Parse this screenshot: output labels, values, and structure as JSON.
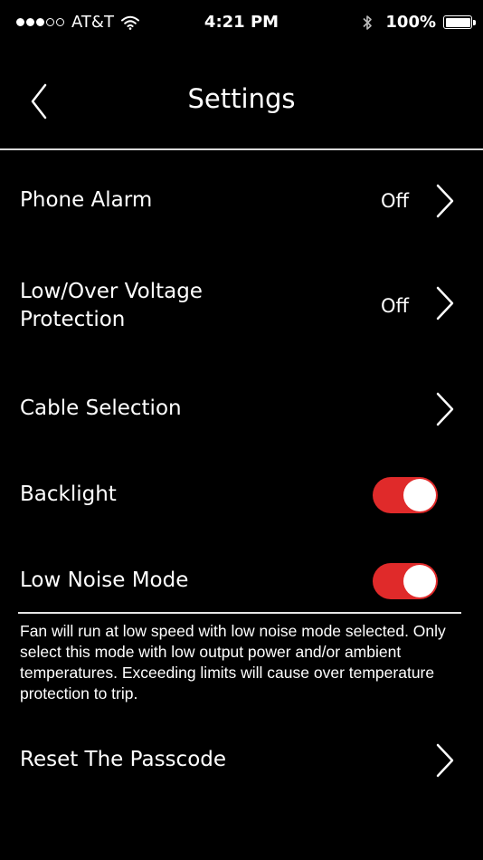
{
  "status_bar": {
    "signal_filled": 3,
    "signal_total": 5,
    "carrier": "AT&T",
    "time": "4:21 PM",
    "battery_percent": "100%",
    "icons": [
      "wifi-icon",
      "bluetooth-icon",
      "battery-icon"
    ]
  },
  "nav": {
    "title": "Settings",
    "back_icon": "chevron-left-icon"
  },
  "settings": {
    "phone_alarm": {
      "label": "Phone Alarm",
      "value": "Off"
    },
    "voltage_protection": {
      "label_line1": "Low/Over Voltage",
      "label_line2": "Protection",
      "value": "Off"
    },
    "cable_selection": {
      "label": "Cable Selection"
    },
    "backlight": {
      "label": "Backlight",
      "enabled": true
    },
    "low_noise_mode": {
      "label": "Low Noise Mode",
      "enabled": true
    },
    "low_noise_note": "Fan will run at low speed with low noise mode selected. Only select this mode with low output power and/or ambient temperatures. Exceeding limits will cause over temperature protection to trip.",
    "reset_passcode": {
      "label": "Reset The Passcode"
    }
  },
  "colors": {
    "background": "#000000",
    "text": "#ffffff",
    "toggle_on": "#e02a2a",
    "divider": "#d8d8d8"
  }
}
